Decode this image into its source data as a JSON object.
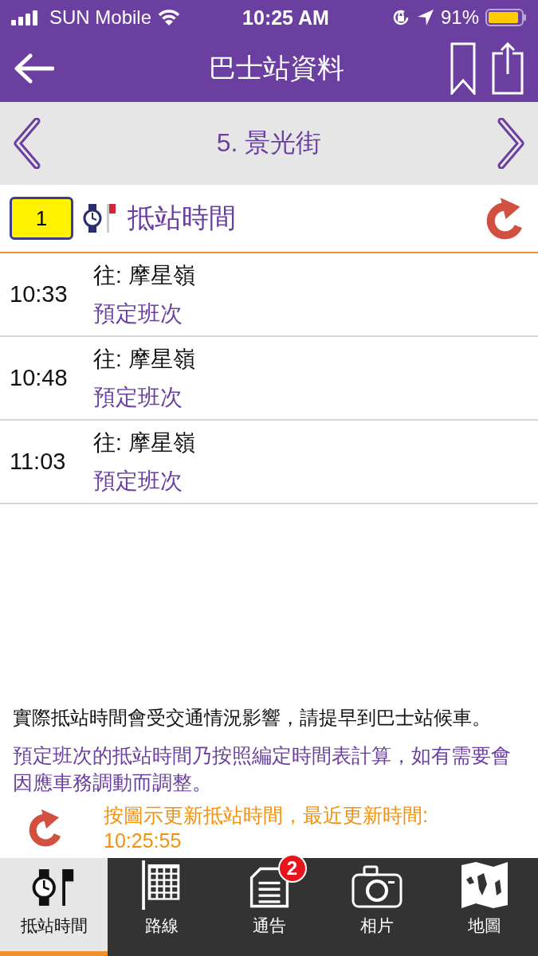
{
  "status_bar": {
    "carrier": "SUN Mobile",
    "time": "10:25 AM",
    "battery": "91%"
  },
  "nav_bar": {
    "title": "巴士站資料"
  },
  "stop_bar": {
    "stop": "5. 景光街"
  },
  "section": {
    "route": "1",
    "title": "抵站時間"
  },
  "arrivals": [
    {
      "time": "10:33",
      "destination": "往: 摩星嶺",
      "note": "預定班次"
    },
    {
      "time": "10:48",
      "destination": "往: 摩星嶺",
      "note": "預定班次"
    },
    {
      "time": "11:03",
      "destination": "往: 摩星嶺",
      "note": "預定班次"
    }
  ],
  "notes": {
    "disclaimer": "實際抵站時間會受交通情況影響，請提早到巴士站候車。",
    "schedule_note": "預定班次的抵站時間乃按照編定時間表計算，如有需要會因應車務調動而調整。",
    "refresh_hint": "按圖示更新抵站時間，最近更新時間:",
    "last_updated": "10:25:55"
  },
  "tab_bar": [
    {
      "label": "抵站時間",
      "selected": true
    },
    {
      "label": "路線",
      "selected": false
    },
    {
      "label": "通告",
      "selected": false,
      "badge": "2"
    },
    {
      "label": "相片",
      "selected": false
    },
    {
      "label": "地圖",
      "selected": false
    }
  ]
}
